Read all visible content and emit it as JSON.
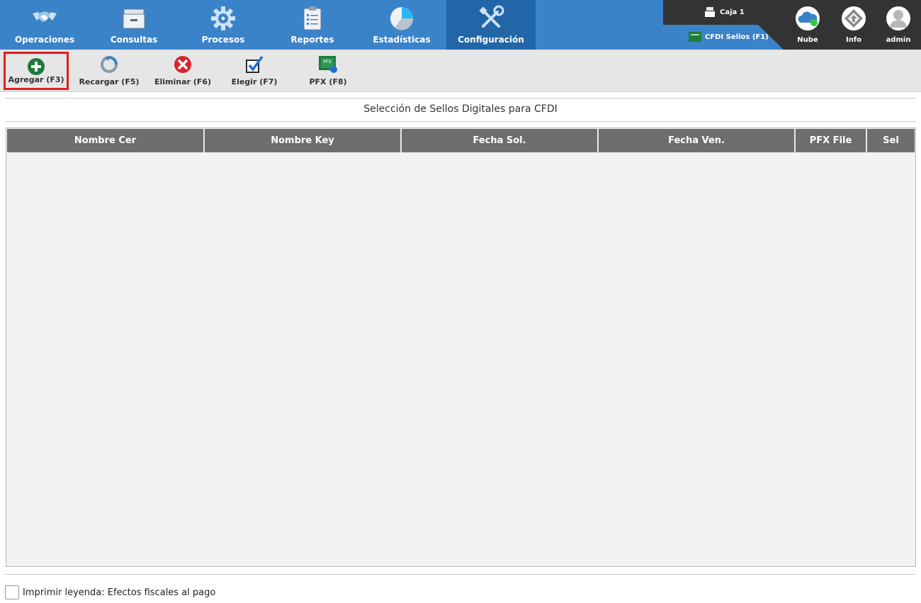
{
  "nav": {
    "tabs": [
      {
        "label": "Operaciones",
        "icon": "handshake-icon"
      },
      {
        "label": "Consultas",
        "icon": "archive-box-icon"
      },
      {
        "label": "Procesos",
        "icon": "gear-icon"
      },
      {
        "label": "Reportes",
        "icon": "clipboard-list-icon"
      },
      {
        "label": "Estadísticas",
        "icon": "pie-chart-icon"
      },
      {
        "label": "Configuración",
        "icon": "tools-icon",
        "active": true
      }
    ],
    "caja": "Caja 1",
    "cfdi_sellos": "CFDI Sellos (F1)",
    "right": [
      {
        "label": "Nube",
        "icon": "cloud-icon"
      },
      {
        "label": "Info",
        "icon": "info-diamond-icon"
      },
      {
        "label": "admin",
        "icon": "user-avatar-icon"
      }
    ]
  },
  "toolbar": {
    "buttons": [
      {
        "label": "Agregar (F3)",
        "icon": "add-circle-icon",
        "highlighted": true
      },
      {
        "label": "Recargar (F5)",
        "icon": "reload-icon"
      },
      {
        "label": "Eliminar (F6)",
        "icon": "delete-circle-icon"
      },
      {
        "label": "Elegir (F7)",
        "icon": "checkbox-check-icon"
      },
      {
        "label": "PFX (F8)",
        "icon": "pfx-file-icon"
      }
    ]
  },
  "main": {
    "title": "Selección de Sellos Digitales para CFDI",
    "columns": [
      "Nombre Cer",
      "Nombre Key",
      "Fecha Sol.",
      "Fecha Ven.",
      "PFX File",
      "Sel"
    ],
    "rows": []
  },
  "footer": {
    "checkbox_label": "Imprimir leyenda: Efectos fiscales al pago",
    "checked": false
  },
  "colors": {
    "nav_blue": "#3b83c9",
    "nav_active": "#2266a8",
    "header_gray": "#6e6e6e",
    "highlight_red": "#e02020"
  }
}
